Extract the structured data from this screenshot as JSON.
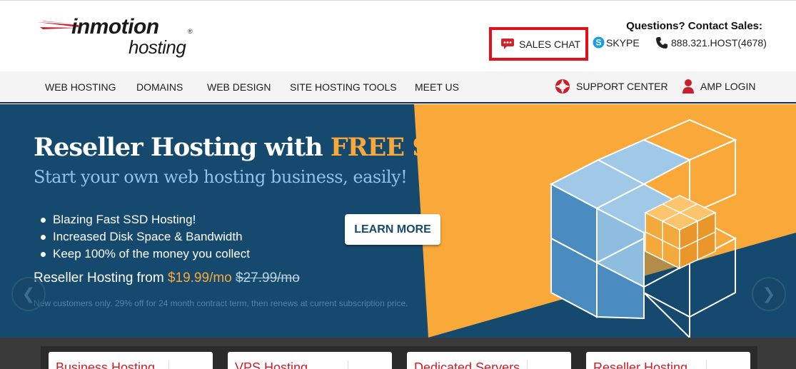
{
  "brand": {
    "logo_main": "inmotion",
    "logo_registered": "®",
    "logo_sub": "hosting"
  },
  "contact": {
    "heading": "Questions? Contact Sales:",
    "sales_chat": "SALES CHAT",
    "skype": "SKYPE",
    "phone": "888.321.HOST(4678)"
  },
  "nav": {
    "items": [
      {
        "label": "WEB HOSTING"
      },
      {
        "label": "DOMAINS"
      },
      {
        "label": "WEB DESIGN"
      },
      {
        "label": "SITE HOSTING TOOLS"
      },
      {
        "label": "MEET US"
      }
    ],
    "support_center": "SUPPORT CENTER",
    "amp_login": "AMP LOGIN"
  },
  "hero": {
    "title": "Reseller Hosting with ",
    "title_accent": "FREE SSD",
    "subtitle": "Start your own web hosting business, easily!",
    "bullets": [
      "Blazing Fast SSD Hosting!",
      "Increased Disk Space & Bandwidth",
      "Keep 100% of the money you collect"
    ],
    "cta": "LEARN MORE",
    "price_prefix": "Reseller Hosting from ",
    "price_new": "$19.99/mo",
    "price_old": "$27.99/mo",
    "fineprint": "New customers only. 29% off for 24 month contract term, then renews at current subscription price.",
    "prev_arrow": "❮",
    "next_arrow": "❯"
  },
  "cards": [
    {
      "title": "Business Hosting"
    },
    {
      "title": "VPS Hosting"
    },
    {
      "title": "Dedicated Servers"
    },
    {
      "title": "Reseller Hosting"
    }
  ],
  "colors": {
    "accent_orange": "#f8a93a",
    "hero_blue": "#15496d",
    "highlight_red": "#e3101c",
    "card_title_red": "#c8202a"
  }
}
